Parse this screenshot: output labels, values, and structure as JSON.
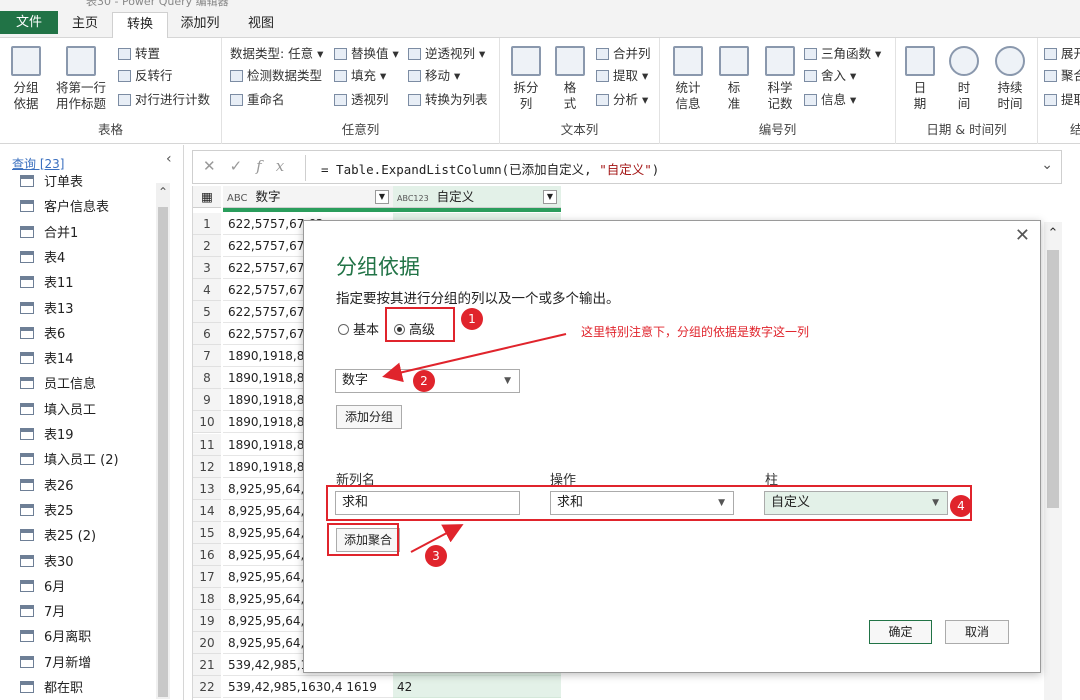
{
  "window": {
    "title": "表30 - Power Query 编辑器"
  },
  "tabs": [
    {
      "label": "文件"
    },
    {
      "label": "主页"
    },
    {
      "label": "转换"
    },
    {
      "label": "添加列"
    },
    {
      "label": "视图"
    }
  ],
  "ribbon": {
    "table_group": {
      "label": "表格",
      "group_by": "分组\n依据",
      "use_first_row": "将第一行\n用作标题",
      "transpose": "转置",
      "reverse_rows": "反转行",
      "count_rows": "对行进行计数"
    },
    "any_column": {
      "label": "任意列",
      "data_type": "数据类型: 任意",
      "detect_type": "检测数据类型",
      "rename": "重命名",
      "replace": "替换值",
      "fill": "填充",
      "pivot": "透视列",
      "unpivot": "逆透视列",
      "move": "移动",
      "to_list": "转换为列表"
    },
    "text_column": {
      "label": "文本列",
      "split": "拆分\n列",
      "format": "格\n式",
      "merge": "合并列",
      "extract": "提取",
      "parse": "分析"
    },
    "number_column": {
      "label": "编号列",
      "statistics": "统计\n信息",
      "standard": "标\n准",
      "scientific": "科学\n记数",
      "trig": "三角函数",
      "rounding": "舍入",
      "information": "信息"
    },
    "datetime_column": {
      "label": "日期 & 时间列",
      "date": "日\n期",
      "time": "时\n间",
      "duration": "持续\n时间"
    },
    "cut": {
      "expand": "展开",
      "aggregate": "聚合",
      "extract_values": "提取",
      "label": "结"
    }
  },
  "queries_pane": {
    "header": "查询 [23]",
    "items": [
      "订单表",
      "客户信息表",
      "合并1",
      "表4",
      "表11",
      "表13",
      "表6",
      "表14",
      "员工信息",
      "填入员工",
      "表19",
      "填入员工 (2)",
      "表26",
      "表25",
      "表25 (2)",
      "表30",
      "6月",
      "7月",
      "6月离职",
      "7月新增",
      "都在职"
    ]
  },
  "formula_bar": {
    "prefix": "= Table.ExpandListColumn(已添加自定义, ",
    "string": "\"自定义\"",
    "suffix": ")"
  },
  "grid": {
    "col1_type": "ABC",
    "col1_name": "数字",
    "col2_type": "ABC123",
    "col2_name": "自定义",
    "rows": [
      {
        "n": "1",
        "v": "622,5757,67,63"
      },
      {
        "n": "2",
        "v": "622,5757,67,63"
      },
      {
        "n": "3",
        "v": "622,5757,67,63"
      },
      {
        "n": "4",
        "v": "622,5757,67,63"
      },
      {
        "n": "5",
        "v": "622,5757,67,63"
      },
      {
        "n": "6",
        "v": "622,5757,67,63"
      },
      {
        "n": "7",
        "v": "1890,1918,831"
      },
      {
        "n": "8",
        "v": "1890,1918,831"
      },
      {
        "n": "9",
        "v": "1890,1918,831"
      },
      {
        "n": "10",
        "v": "1890,1918,831"
      },
      {
        "n": "11",
        "v": "1890,1918,831"
      },
      {
        "n": "12",
        "v": "1890,1918,831"
      },
      {
        "n": "13",
        "v": "8,925,95,64,05"
      },
      {
        "n": "14",
        "v": "8,925,95,64,05"
      },
      {
        "n": "15",
        "v": "8,925,95,64,05"
      },
      {
        "n": "16",
        "v": "8,925,95,64,05"
      },
      {
        "n": "17",
        "v": "8,925,95,64,05"
      },
      {
        "n": "18",
        "v": "8,925,95,64,05"
      },
      {
        "n": "19",
        "v": "8,925,95,64,05"
      },
      {
        "n": "20",
        "v": "8,925,95,64,05"
      },
      {
        "n": "21",
        "v": "539,42,985,1630"
      },
      {
        "n": "22",
        "v": "539,42,985,1630,4 1619",
        "v2": "42"
      }
    ]
  },
  "dialog": {
    "title": "分组依据",
    "description": "指定要按其进行分组的列以及一个或多个输出。",
    "radio_basic": "基本",
    "radio_advanced": "高级",
    "group_column": "数字",
    "add_group": "添加分组",
    "new_col_header": "新列名",
    "operation_header": "操作",
    "column_header": "柱",
    "new_col_value": "求和",
    "operation_value": "求和",
    "column_value": "自定义",
    "add_aggregation": "添加聚合",
    "ok": "确定",
    "cancel": "取消"
  },
  "annotations": {
    "note": "这里特别注意下，分组的依据是数字这一列",
    "badge1": "1",
    "badge2": "2",
    "badge3": "3",
    "badge4": "4",
    "color": "#e0242c"
  }
}
